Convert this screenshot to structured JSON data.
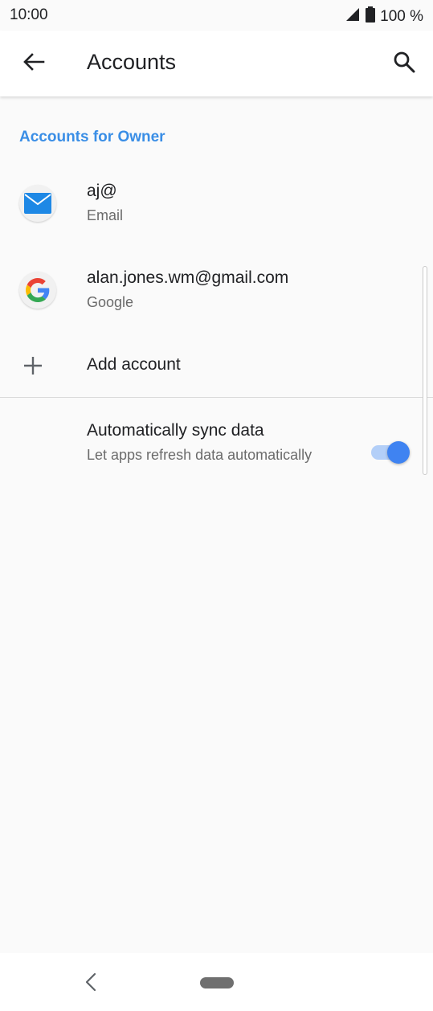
{
  "status_bar": {
    "time": "10:00",
    "battery": "100 %",
    "icons": [
      "signal-icon",
      "battery-icon"
    ]
  },
  "toolbar": {
    "title": "Accounts",
    "back_icon": "arrow-left-icon",
    "search_icon": "search-icon"
  },
  "section": {
    "header": "Accounts for Owner"
  },
  "accounts": [
    {
      "title": "aj@",
      "subtitle": "Email",
      "icon": "email-envelope-icon"
    },
    {
      "title": "alan.jones.wm@gmail.com",
      "subtitle": "Google",
      "icon": "google-g-icon"
    }
  ],
  "add_account": {
    "label": "Add account",
    "icon": "plus-icon"
  },
  "sync": {
    "title": "Automatically sync data",
    "subtitle": "Let apps refresh data automatically",
    "enabled": true
  },
  "colors": {
    "accent": "#3a8ee6",
    "toggle_on": "#3f83f1",
    "toggle_track": "#b3cff8"
  },
  "nav_bar": {
    "back_icon": "nav-back-icon",
    "home_icon": "nav-home-pill-icon"
  }
}
